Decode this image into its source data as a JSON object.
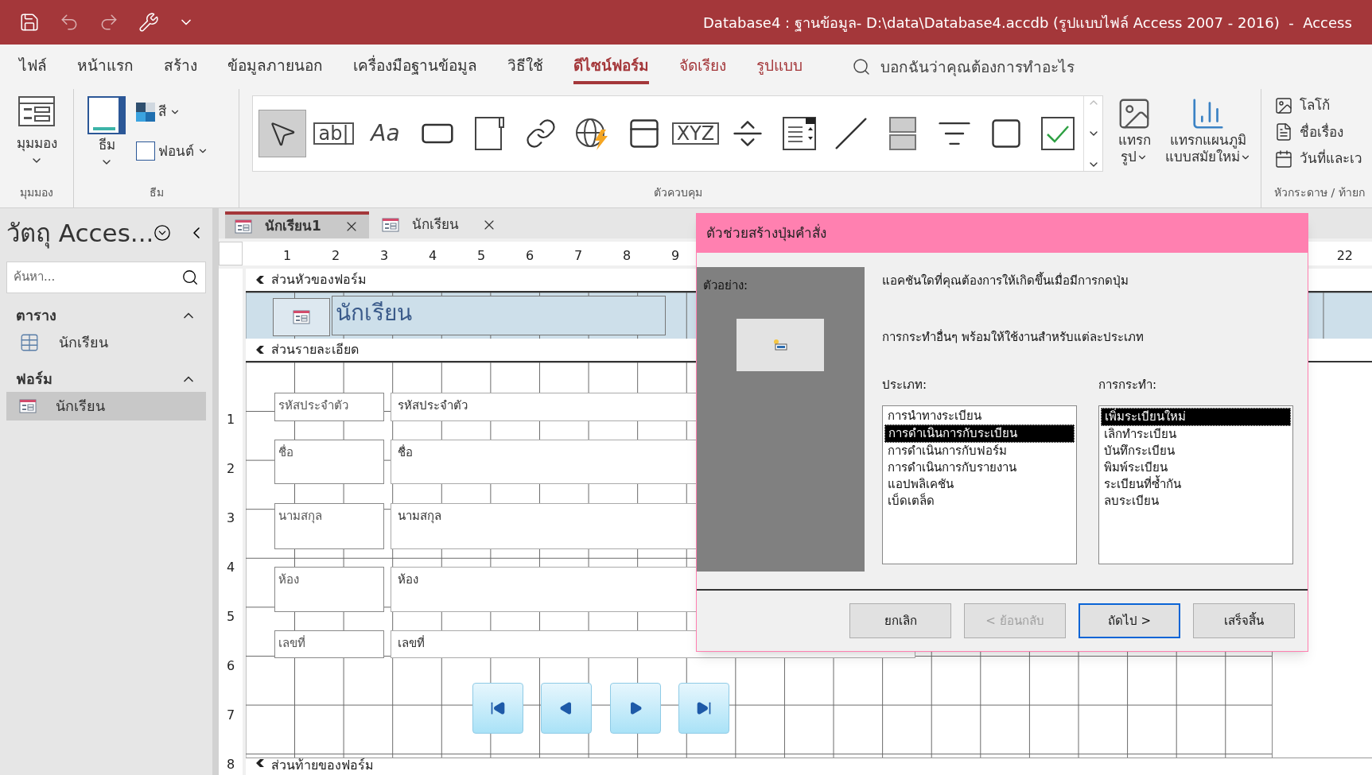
{
  "window": {
    "title": "Database4 : ฐานข้อมูล- D:\\data\\Database4.accdb (รูปแบบไฟล์ Access 2007 - 2016)  -  Access"
  },
  "ribbon_tabs": [
    {
      "label": "ไฟล์",
      "kind": "normal",
      "selected": false
    },
    {
      "label": "หน้าแรก",
      "kind": "normal",
      "selected": false
    },
    {
      "label": "สร้าง",
      "kind": "normal",
      "selected": false
    },
    {
      "label": "ข้อมูลภายนอก",
      "kind": "normal",
      "selected": false
    },
    {
      "label": "เครื่องมือฐานข้อมูล",
      "kind": "normal",
      "selected": false
    },
    {
      "label": "วิธีใช้",
      "kind": "normal",
      "selected": false
    },
    {
      "label": "ดีไซน์ฟอร์ม",
      "kind": "contextual",
      "selected": true
    },
    {
      "label": "จัดเรียง",
      "kind": "contextual",
      "selected": false
    },
    {
      "label": "รูปแบบ",
      "kind": "contextual",
      "selected": false
    }
  ],
  "tell_me": {
    "placeholder": "บอกฉันว่าคุณต้องการทำอะไร"
  },
  "ribbon": {
    "views": {
      "button": "มุมมอง",
      "group": "มุมมอง"
    },
    "themes": {
      "theme": "ธีม",
      "colors": "สี",
      "fonts": "ฟอนต์",
      "group": "ธีม"
    },
    "controls": {
      "group": "ตัวควบคุม",
      "items": [
        {
          "kind": "pointer",
          "selected": true
        },
        {
          "kind": "boxed_glyph",
          "text": "ab|",
          "selected": false
        },
        {
          "kind": "glyph",
          "text": "Aa",
          "selected": false
        },
        {
          "kind": "button",
          "selected": false
        },
        {
          "kind": "tab",
          "selected": false
        },
        {
          "kind": "link",
          "selected": false
        },
        {
          "kind": "web",
          "selected": false
        },
        {
          "kind": "navigation",
          "selected": false
        },
        {
          "kind": "boxed_glyph",
          "text": "XYZ",
          "selected": false
        },
        {
          "kind": "pagebreak",
          "selected": false
        },
        {
          "kind": "combo",
          "selected": false
        },
        {
          "kind": "line",
          "selected": false
        },
        {
          "kind": "toggle",
          "selected": false
        },
        {
          "kind": "listbox",
          "selected": false
        },
        {
          "kind": "rectangle",
          "selected": false
        },
        {
          "kind": "checkbox",
          "selected": false
        }
      ]
    },
    "insert_image": [
      "แทรก",
      "รูป"
    ],
    "insert_chart": [
      "แทรกแผนภูมิ",
      "แบบสมัยใหม่"
    ],
    "header_footer": {
      "items": [
        {
          "kind": "logo",
          "label": "โลโก้"
        },
        {
          "kind": "title",
          "label": "ชื่อเรื่อง"
        },
        {
          "kind": "date",
          "label": "วันที่และเว"
        }
      ],
      "group": "หัวกระดาษ / ท้ายก"
    }
  },
  "nav_pane": {
    "title": "วัตถุ Acces...",
    "search": {
      "placeholder": "ค้นหา..."
    },
    "groups": [
      {
        "label": "ตาราง",
        "expanded": true,
        "items": [
          {
            "label": "นักเรียน",
            "kind": "table",
            "selected": false
          }
        ]
      },
      {
        "label": "ฟอร์ม",
        "expanded": true,
        "items": [
          {
            "label": "นักเรียน",
            "kind": "form",
            "selected": true
          }
        ]
      }
    ]
  },
  "doc_tabs": [
    {
      "label": "นักเรียน1",
      "selected": true
    },
    {
      "label": "นักเรียน",
      "selected": false
    }
  ],
  "ruler": {
    "marks": [
      "1",
      "2",
      "3",
      "4",
      "5",
      "6",
      "7",
      "8",
      "9"
    ],
    "right_mark": "22",
    "vertical_marks": [
      "1",
      "2",
      "3",
      "4",
      "5",
      "6",
      "7",
      "8"
    ]
  },
  "form": {
    "header_section": "ส่วนหัวของฟอร์ม",
    "title": "นักเรียน",
    "detail_section": "ส่วนรายละเอียด",
    "footer_section": "ส่วนท้ายของฟอร์ม",
    "fields": [
      {
        "label": "รหัสประจำตัว",
        "value": "รหัสประจำตัว"
      },
      {
        "label": "ชื่อ",
        "value": "ชื่อ"
      },
      {
        "label": "นามสกุล",
        "value": "นามสกุล"
      },
      {
        "label": "ห้อง",
        "value": "ห้อง"
      },
      {
        "label": "เลขที่",
        "value": "เลขที่"
      }
    ],
    "nav_buttons": [
      {
        "kind": "first"
      },
      {
        "kind": "previous"
      },
      {
        "kind": "next"
      },
      {
        "kind": "last"
      }
    ]
  },
  "dialog": {
    "title": "ตัวช่วยสร้างปุ่มคำสั่ง",
    "sample_label": "ตัวอย่าง:",
    "prompt": "แอคชันใดที่คุณต้องการให้เกิดขึ้นเมื่อมีการกดปุ่ม",
    "info": "การกระทำอื่นๆ พร้อมให้ใช้งานสำหรับแต่ละประเภท",
    "categories_label": "ประเภท:",
    "categories": [
      {
        "label": "การนำทางระเบียน",
        "selected": false
      },
      {
        "label": "การดำเนินการกับระเบียน",
        "selected": true
      },
      {
        "label": "การดำเนินการกับฟอร์ม",
        "selected": false
      },
      {
        "label": "การดำเนินการกับรายงาน",
        "selected": false
      },
      {
        "label": "แอปพลิเคชัน",
        "selected": false
      },
      {
        "label": "เบ็ดเตล็ด",
        "selected": false
      }
    ],
    "actions_label": "การกระทำ:",
    "actions": [
      {
        "label": "เพิ่มระเบียนใหม่",
        "selected": true
      },
      {
        "label": "เลิกทำระเบียน",
        "selected": false
      },
      {
        "label": "บันทึกระเบียน",
        "selected": false
      },
      {
        "label": "พิมพ์ระเบียน",
        "selected": false
      },
      {
        "label": "ระเบียนที่ซ้ำกัน",
        "selected": false
      },
      {
        "label": "ลบระเบียน",
        "selected": false
      }
    ],
    "buttons": [
      {
        "label": "ยกเลิก",
        "disabled": false,
        "default": false
      },
      {
        "label": "< ย้อนกลับ",
        "disabled": true,
        "default": false
      },
      {
        "label": "ถัดไป >",
        "disabled": false,
        "default": true
      },
      {
        "label": "เสร็จสิ้น",
        "disabled": false,
        "default": false
      }
    ]
  }
}
